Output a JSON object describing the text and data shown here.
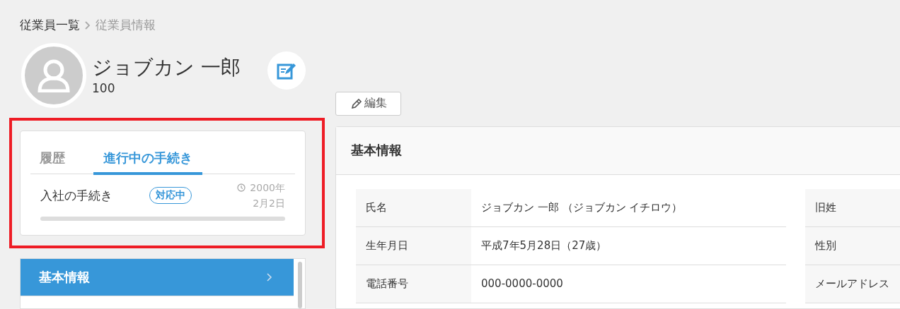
{
  "breadcrumb": [
    {
      "label": "従業員一覧",
      "current": false
    },
    {
      "label": "従業員情報",
      "current": true
    }
  ],
  "employee": {
    "name": "ジョブカン 一郎",
    "number": "100"
  },
  "procedures": {
    "tabs": [
      {
        "label": "履歴",
        "selected": false
      },
      {
        "label": "進行中の手続き",
        "selected": true
      }
    ],
    "items": [
      {
        "title": "入社の手続き",
        "status": "対応中",
        "date_year": "2000年",
        "date_day": "2月2日",
        "level": 0
      }
    ]
  },
  "menu": [
    {
      "label": "基本情報",
      "selected": true
    }
  ],
  "edit_button": "編集",
  "panel": {
    "title": "基本情報",
    "left_rows": [
      {
        "label": "氏名",
        "value": "ジョブカン 一郎 （ジョブカン イチロウ）"
      },
      {
        "label": "生年月日",
        "value": "平成7年5月28日（27歳）"
      },
      {
        "label": "電話番号",
        "value": "000-0000-0000"
      }
    ],
    "right_rows": [
      {
        "label": "旧姓"
      },
      {
        "label": "性別"
      },
      {
        "label": "メールアドレス"
      }
    ]
  }
}
